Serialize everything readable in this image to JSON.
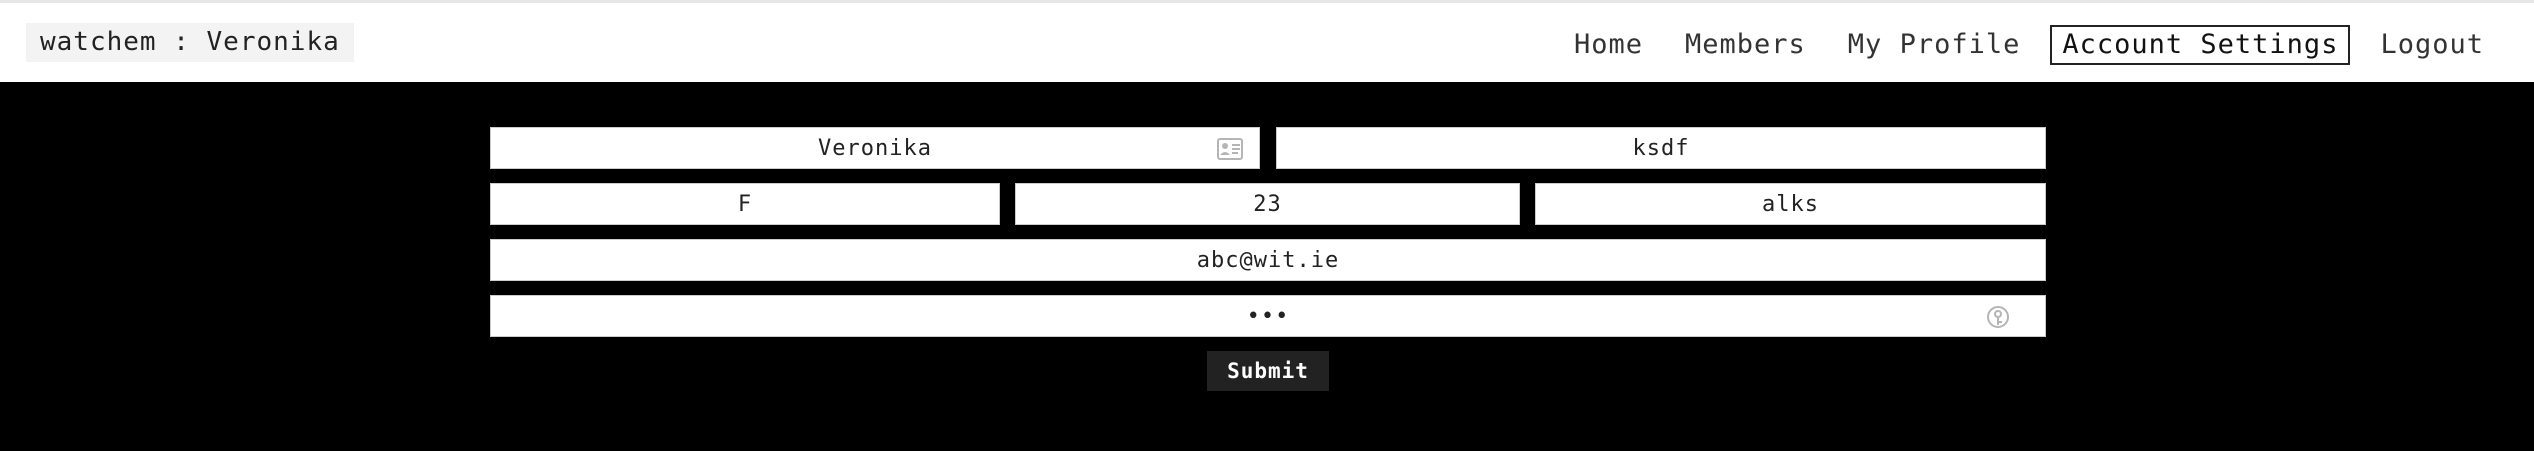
{
  "header": {
    "brand": "watchem : Veronika",
    "nav": [
      {
        "label": "Home"
      },
      {
        "label": "Members"
      },
      {
        "label": "My Profile"
      },
      {
        "label": "Account Settings",
        "active": true
      },
      {
        "label": "Logout"
      }
    ]
  },
  "form": {
    "first_name": "Veronika",
    "last_name": "ksdf",
    "gender": "F",
    "age": "23",
    "occupation": "alks",
    "email": "abc@wit.ie",
    "password": "abc",
    "submit_label": "Submit"
  },
  "icons": {
    "contact_card": "contact-card-icon",
    "password_key": "password-key-icon"
  },
  "colors": {
    "page_background": "#000000",
    "header_background": "#ffffff",
    "button_background": "#222222"
  }
}
